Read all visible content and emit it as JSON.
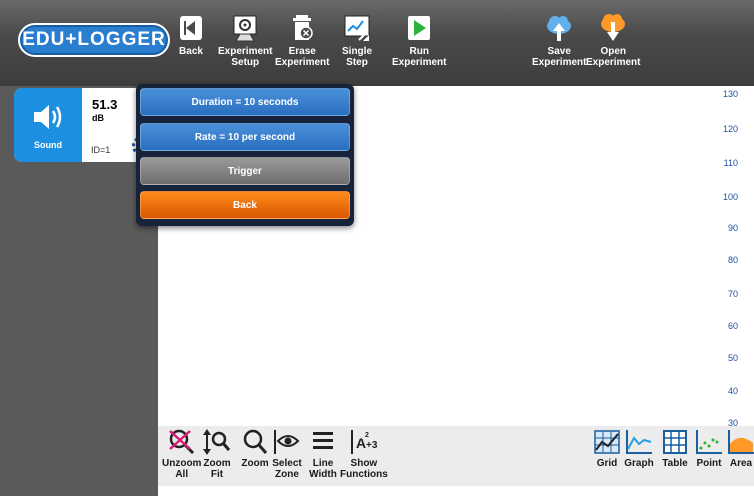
{
  "app": {
    "logo": "EDU+LOGGER"
  },
  "toolbar": {
    "back": "Back",
    "experiment_setup": "Experiment\nSetup",
    "erase_experiment": "Erase\nExperiment",
    "single_step": "Single\nStep",
    "run_experiment": "Run\nExperiment",
    "save_experiment": "Save\nExperiment",
    "open_experiment": "Open\nExperiment"
  },
  "sensor": {
    "name": "Sound",
    "value": "51.3",
    "unit": "dB",
    "id": "ID=1"
  },
  "menu": {
    "duration": "Duration = 10 seconds",
    "rate": "Rate = 10 per second",
    "trigger": "Trigger",
    "back": "Back"
  },
  "graph": {
    "y_ticks": [
      "130",
      "120",
      "110",
      "100",
      "90",
      "80",
      "70",
      "60",
      "50",
      "40",
      "30"
    ]
  },
  "bottom_tools": {
    "unzoom_all": "Unzoom\nAll",
    "zoom_fit": "Zoom\nFit",
    "zoom": "Zoom",
    "select_zone": "Select\nZone",
    "line_width": "Line\nWidth",
    "show_functions": "Show\nFunctions",
    "grid": "Grid",
    "graph": "Graph",
    "table": "Table",
    "point": "Point",
    "area": "Area"
  },
  "colors": {
    "accent_blue": "#1d8fe0",
    "menu_orange": "#d95800",
    "axis_text": "#1d4fa0"
  }
}
